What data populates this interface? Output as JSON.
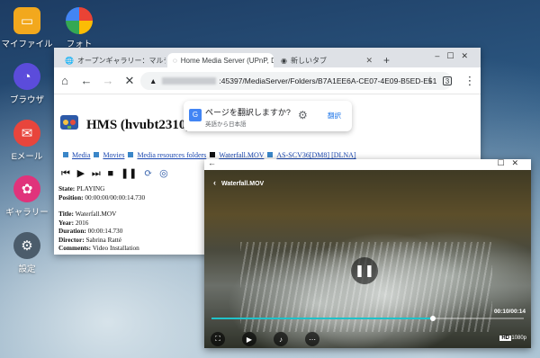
{
  "desktop": {
    "icons": [
      {
        "label": "マイファイル",
        "icon": "folder-icon",
        "color": "#f2a81d"
      },
      {
        "label": "フォト",
        "icon": "photos-icon",
        "color": "#ffffff"
      },
      {
        "label": "ブラウザ",
        "icon": "browser-icon",
        "color": "#5b4cdb"
      },
      {
        "label": "Eメール",
        "icon": "email-icon",
        "color": "#e8453c"
      },
      {
        "label": "ギャラリー",
        "icon": "gallery-icon",
        "color": "#e0337b"
      },
      {
        "label": "設定",
        "icon": "settings-icon",
        "color": "#4b5c6b"
      }
    ]
  },
  "browser": {
    "tabs": [
      {
        "label": "オープンギャラリー：マルチ",
        "active": false
      },
      {
        "label": "Home Media Server (UPnP, D",
        "active": true
      },
      {
        "label": "新しいタブ",
        "active": false
      }
    ],
    "new_tab": "+",
    "url": ":45397/MediaServer/Folders/B7A1EE6A-CE07-4E09-B5ED-E51",
    "tab_count": "3",
    "translate": {
      "title": "ページを翻訳しますか?",
      "subtitle": "英語から日本語",
      "action": "翻訳"
    }
  },
  "page": {
    "title": "HMS (hvubt2310)",
    "breadcrumbs": [
      "Media",
      "Movies",
      "Media resources folders",
      "Waterfall.MOV",
      "AS-SCV36[DM8] [DLNA]"
    ],
    "info": {
      "state_label": "State:",
      "state_value": "PLAYING",
      "position_label": "Position:",
      "position_value": "00:00:00/00:00:14.730",
      "title_label": "Title:",
      "title_value": "Waterfall.MOV",
      "year_label": "Year:",
      "year_value": "2016",
      "duration_label": "Duration:",
      "duration_value": "00:00:14.730",
      "director_label": "Director:",
      "director_value": "Sabrina Ratté",
      "comments_label": "Comments:",
      "comments_value": "Video Installation"
    }
  },
  "video": {
    "title": "Waterfall.MOV",
    "time": "00:10/00:14",
    "progress": 0.71,
    "hd": "HD",
    "resolution": "1080p"
  }
}
